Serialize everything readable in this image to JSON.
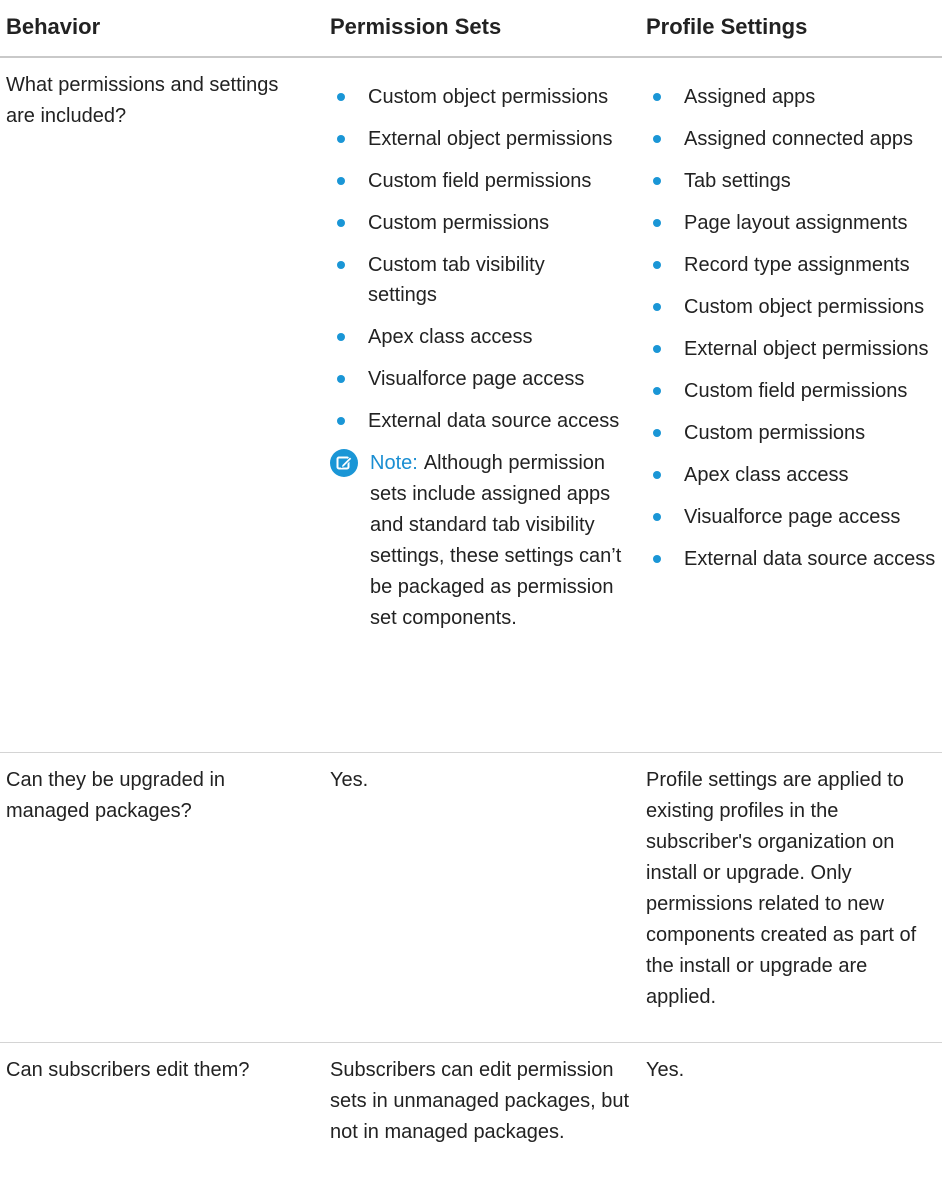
{
  "headers": {
    "behavior": "Behavior",
    "permission_sets": "Permission Sets",
    "profile_settings": "Profile Settings"
  },
  "rows": [
    {
      "behavior": "What permissions and settings are included?",
      "permission_sets_items": [
        "Custom object permissions",
        "External object permissions",
        "Custom field permissions",
        "Custom permissions",
        "Custom tab visibility settings",
        "Apex class access",
        "Visualforce page access",
        "External data source access"
      ],
      "note_label": "Note:",
      "note_text": "Although permission sets include assigned apps and standard tab visibility settings, these settings can’t be packaged as permission set components.",
      "profile_items": [
        "Assigned apps",
        "Assigned connected apps",
        "Tab settings",
        "Page layout assignments",
        "Record type assignments",
        "Custom object permissions",
        "External object permissions",
        "Custom field permissions",
        "Custom permissions",
        "Apex class access",
        "Visualforce page access",
        "External data source access"
      ]
    },
    {
      "behavior": "Can they be upgraded in managed packages?",
      "permission_sets": "Yes.",
      "profile_settings": "Profile settings are applied to existing profiles in the subscriber's organization on install or upgrade. Only permissions related to new components created as part of the install or upgrade are applied."
    },
    {
      "behavior": "Can subscribers edit them?",
      "permission_sets": "Subscribers can edit permission sets in unmanaged packages, but not in managed packages.",
      "profile_settings": "Yes."
    }
  ],
  "icons": {
    "note": "edit-note-icon"
  },
  "colors": {
    "accent": "#1a96d6"
  }
}
